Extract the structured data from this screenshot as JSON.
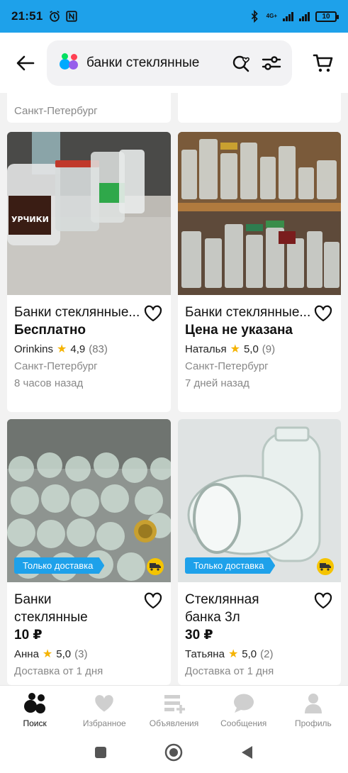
{
  "status_bar": {
    "time": "21:51",
    "battery": "10",
    "network": "4G+"
  },
  "header": {
    "search_query": "банки стеклянные",
    "icons": [
      "back-arrow-icon",
      "app-logo-icon",
      "search-heart-icon",
      "filter-icon",
      "cart-icon"
    ]
  },
  "top_partial": {
    "left_city": "Санкт-Петербург"
  },
  "listings": [
    {
      "title": "Банки стеклянные...",
      "price": "Бесплатно",
      "seller": "Orinkins",
      "rating": "4,9",
      "reviews": "(83)",
      "location": "Санкт-Петербург",
      "time": "8 часов назад",
      "badge": ""
    },
    {
      "title": "Банки стеклянные...",
      "price": "Цена не указана",
      "seller": "Наталья",
      "rating": "5,0",
      "reviews": "(9)",
      "location": "Санкт-Петербург",
      "time": "7 дней назад",
      "badge": ""
    },
    {
      "title": "Банки стеклянные",
      "price": "10 ₽",
      "seller": "Анна",
      "rating": "5,0",
      "reviews": "(3)",
      "location": "",
      "time": "Доставка от 1 дня",
      "badge": "Только доставка"
    },
    {
      "title": "Стеклянная банка 3л",
      "price": "30 ₽",
      "seller": "Татьяна",
      "rating": "5,0",
      "reviews": "(2)",
      "location": "",
      "time": "Доставка от 1 дня",
      "badge": "Только доставка"
    }
  ],
  "bottom_nav": [
    {
      "label": "Поиск",
      "icon": "search-dots-icon",
      "active": true
    },
    {
      "label": "Избранное",
      "icon": "heart-icon",
      "active": false
    },
    {
      "label": "Объявления",
      "icon": "add-listing-icon",
      "active": false
    },
    {
      "label": "Сообщения",
      "icon": "chat-icon",
      "active": false
    },
    {
      "label": "Профиль",
      "icon": "profile-icon",
      "active": false
    }
  ],
  "colors": {
    "accent": "#1ea1ea",
    "star": "#f5b301",
    "truck_badge": "#f5c400"
  }
}
